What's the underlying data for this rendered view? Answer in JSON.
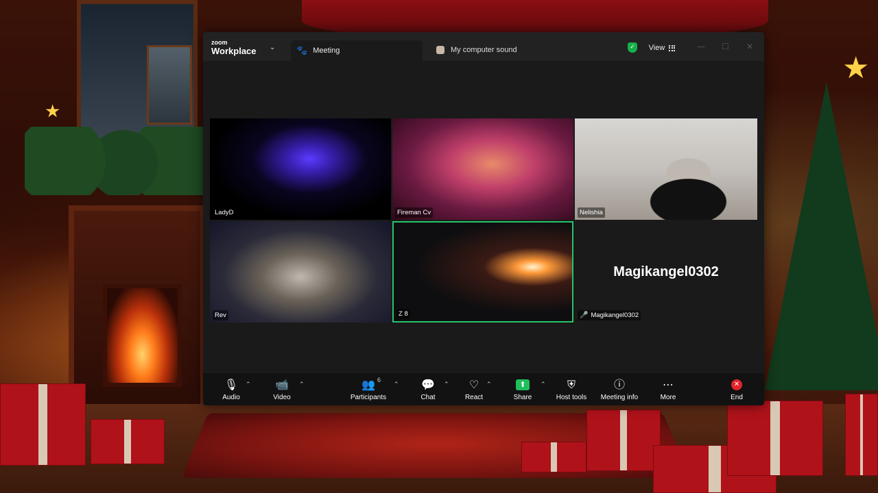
{
  "app": {
    "brand_small": "zoom",
    "brand_name": "Workplace"
  },
  "tabs": {
    "meeting": "Meeting",
    "sound": "My computer sound"
  },
  "titlebar": {
    "view_label": "View"
  },
  "participants": [
    {
      "name": "LadyD"
    },
    {
      "name": "Fireman Cv"
    },
    {
      "name": "Nelishia"
    },
    {
      "name": "Rev"
    },
    {
      "name": "Z 8",
      "active_speaker": true
    },
    {
      "name": "Magikangel0302",
      "video_off": true,
      "muted": true
    }
  ],
  "toolbar": {
    "audio": "Audio",
    "video": "Video",
    "participants": "Participants",
    "participants_count": "6",
    "chat": "Chat",
    "react": "React",
    "share": "Share",
    "host_tools": "Host tools",
    "meeting_info": "Meeting info",
    "more": "More",
    "end": "End"
  },
  "colors": {
    "active_speaker_border": "#27c46a",
    "share_green": "#1fbf5b",
    "end_red": "#e0252b",
    "shield_green": "#17b04a"
  }
}
